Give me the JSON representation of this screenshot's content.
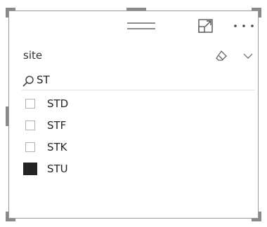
{
  "slicer": {
    "title": "site",
    "search": {
      "value": "ST",
      "placeholder": "Search"
    },
    "items": [
      {
        "label": "STD",
        "checked": false
      },
      {
        "label": "STF",
        "checked": false
      },
      {
        "label": "STK",
        "checked": false
      },
      {
        "label": "STU",
        "checked": true
      }
    ]
  },
  "icons": {
    "drag": "drag-grip-icon",
    "focus": "focus-mode-icon",
    "more": "more-options-icon",
    "eraser": "clear-selections-icon",
    "chevron": "chevron-down-icon",
    "search": "search-icon"
  },
  "colors": {
    "handle": "#8a8a8a",
    "border": "#9b9b9b",
    "checked": "#252423",
    "unchecked_border": "#b3b3b3"
  }
}
